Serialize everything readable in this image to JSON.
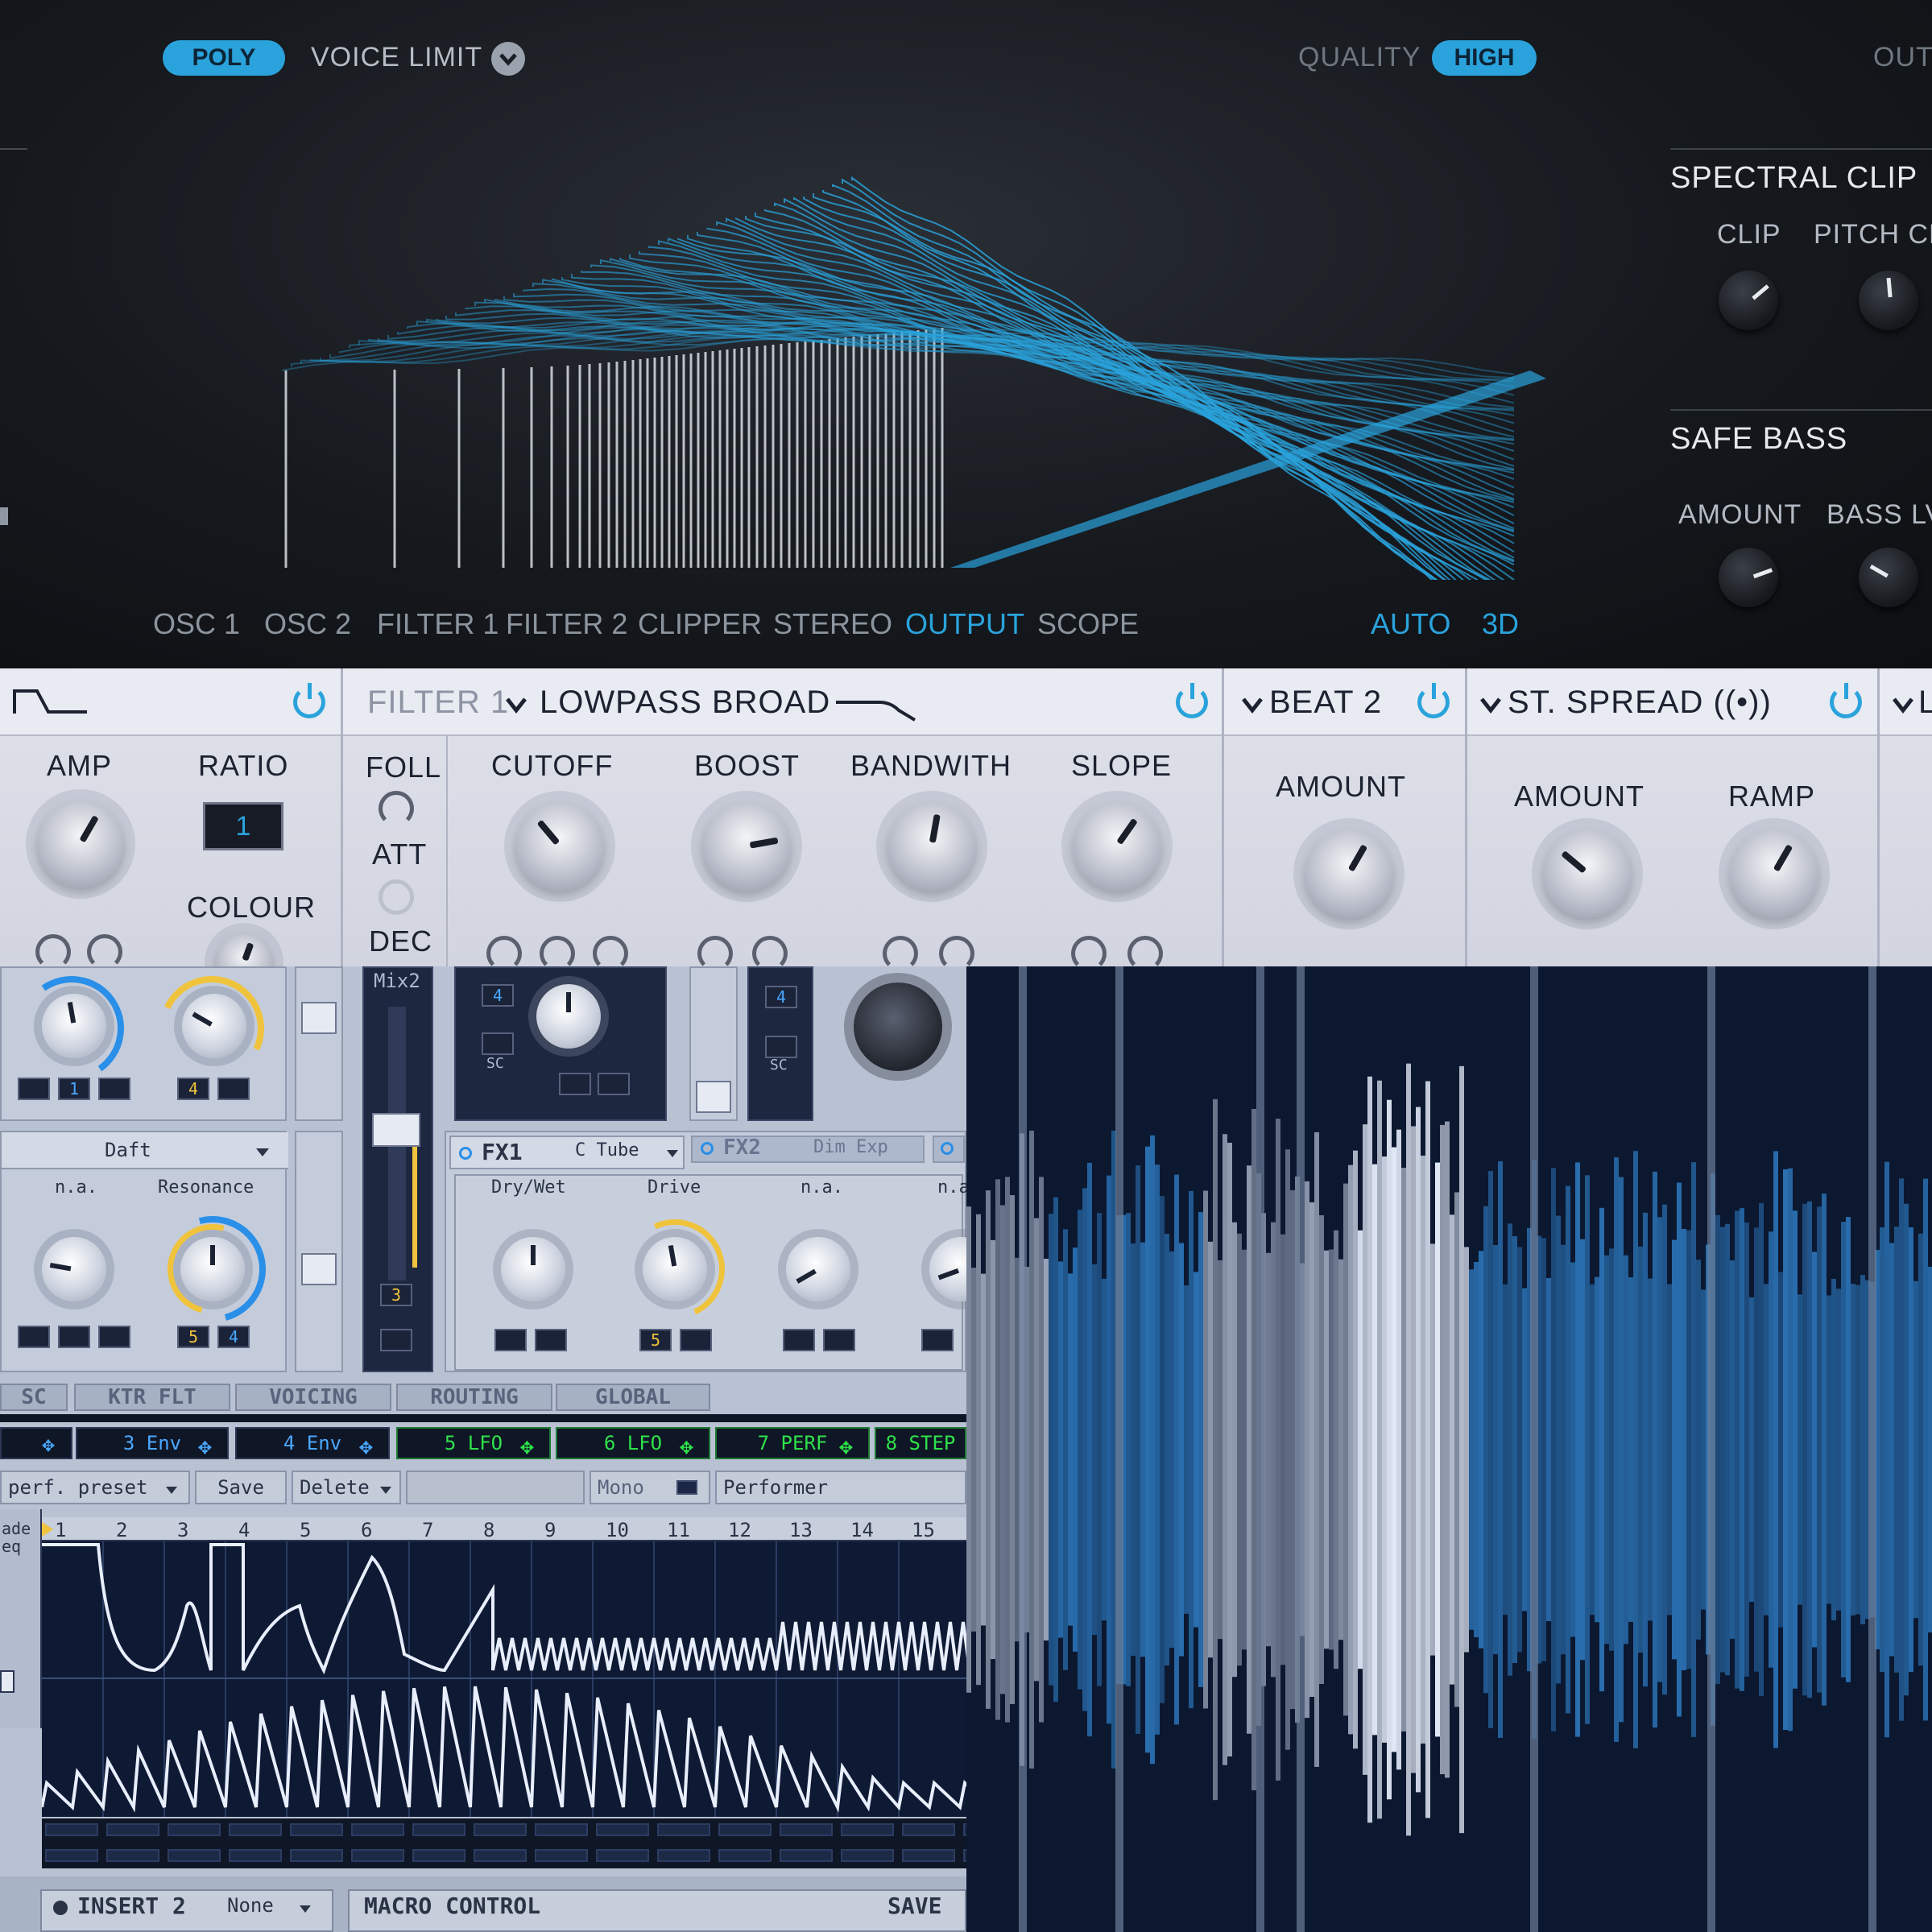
{
  "top": {
    "poly": "POLY",
    "voice_limit": "VOICE LIMIT",
    "voice_limit_icon": "chevron-down-icon",
    "quality_label": "QUALITY",
    "quality_value": "HIGH",
    "out_label": "OUT",
    "spectral_clip": {
      "title": "SPECTRAL CLIP",
      "clip": "CLIP",
      "pitch": "PITCH CL"
    },
    "safe_bass": {
      "title": "SAFE BASS",
      "amount": "AMOUNT",
      "bass": "BASS LV"
    },
    "tabs": [
      "OSC 1",
      "OSC 2",
      "FILTER 1",
      "FILTER 2",
      "CLIPPER",
      "STEREO",
      "OUTPUT",
      "SCOPE"
    ],
    "active_tab": "OUTPUT",
    "auto": "AUTO",
    "three_d": "3D",
    "colors": {
      "accent": "#2aa3dc"
    }
  },
  "mid": {
    "amp": "AMP",
    "ratio": "RATIO",
    "ratio_value": "1",
    "colour": "COLOUR",
    "filter_label": "FILTER 1",
    "filter_type": "LOWPASS BROAD",
    "foll": "FOLL",
    "att": "ATT",
    "dec": "DEC",
    "cutoff": "CUTOFF",
    "boost": "BOOST",
    "bandwith": "BANDWITH",
    "slope": "SLOPE",
    "beat_title": "BEAT 2",
    "beat_amount": "AMOUNT",
    "spread_title": "ST. SPREAD ((•))",
    "spread_amount": "AMOUNT",
    "spread_ramp": "RAMP",
    "cut_title": "L"
  },
  "bl": {
    "slot_1": "1",
    "slot_4": "4",
    "mix2": "Mix2",
    "voice_value": "4",
    "sc": "SC",
    "filter_preset": "Daft",
    "na": "n.a.",
    "resonance": "Resonance",
    "slot_5": "5",
    "slot_4b": "4",
    "slot_3": "3",
    "fx1": "FX1",
    "fx1_type": "C Tube",
    "fx2": "FX2",
    "fx2_type": "Dim Exp",
    "drywet": "Dry/Wet",
    "drive": "Drive",
    "na2": "n.a.",
    "na3": "n.a",
    "fx_slot_5": "5",
    "tabs": [
      "SC",
      "KTR FLT",
      "VOICING",
      "ROUTING",
      "GLOBAL"
    ],
    "mod_tabs": [
      "3 Env",
      "4 Env",
      "5 LFO",
      "6 LFO",
      "7 PERF",
      "8 STEP"
    ],
    "perf_preset": "perf. preset",
    "save": "Save",
    "delete": "Delete",
    "mono": "Mono",
    "performer": "Performer",
    "side_labels": [
      "ade",
      "eq"
    ],
    "steps": [
      "1",
      "2",
      "3",
      "4",
      "5",
      "6",
      "7",
      "8",
      "9",
      "10",
      "11",
      "12",
      "13",
      "14",
      "15"
    ],
    "insert": "INSERT 2",
    "insert_value": "None",
    "macro": "MACRO CONTROL",
    "save_macro": "SAVE"
  },
  "br": {
    "colors": {
      "blue": "#2a6fb0",
      "grey": "#9aa4b8",
      "white": "#dfe6f4",
      "dark": "#0b1830"
    }
  }
}
